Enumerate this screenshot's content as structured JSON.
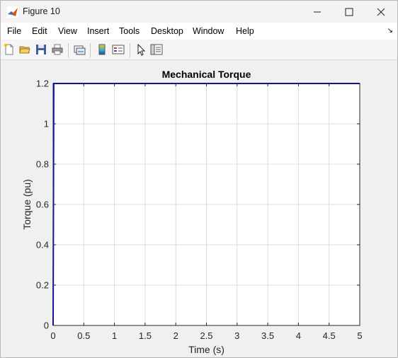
{
  "window": {
    "title": "Figure 10"
  },
  "icons": {
    "app": "matlab-icon",
    "minimize": "minimize-icon",
    "maximize": "maximize-icon",
    "close": "close-icon",
    "new": "new-figure-icon",
    "open": "open-file-icon",
    "save": "save-icon",
    "print": "print-icon",
    "link": "link-plot-icon",
    "colorbar": "colorbar-icon",
    "legend": "legend-icon",
    "pointer": "edit-plot-pointer-icon",
    "property": "property-inspector-icon"
  },
  "menu": {
    "items": [
      "File",
      "Edit",
      "View",
      "Insert",
      "Tools",
      "Desktop",
      "Window",
      "Help"
    ],
    "overflow": "↘"
  },
  "chart_data": {
    "type": "line",
    "title": "Mechanical Torque",
    "xlabel": "Time (s)",
    "ylabel": "Torque (pu)",
    "xlim": [
      0,
      5
    ],
    "ylim": [
      0,
      1.2
    ],
    "xticks": [
      0,
      0.5,
      1,
      1.5,
      2,
      2.5,
      3,
      3.5,
      4,
      4.5,
      5
    ],
    "xtick_labels": [
      "0",
      "0.5",
      "1",
      "1.5",
      "2",
      "2.5",
      "3",
      "3.5",
      "4",
      "4.5",
      "5"
    ],
    "yticks": [
      0,
      0.2,
      0.4,
      0.6,
      0.8,
      1,
      1.2
    ],
    "ytick_labels": [
      "0",
      "0.2",
      "0.4",
      "0.6",
      "0.8",
      "1",
      "1.2"
    ],
    "grid": true,
    "series": [
      {
        "color": "#0000ff",
        "x": [
          0,
          0.01,
          5
        ],
        "y": [
          0,
          1.2,
          1.2
        ]
      }
    ]
  }
}
